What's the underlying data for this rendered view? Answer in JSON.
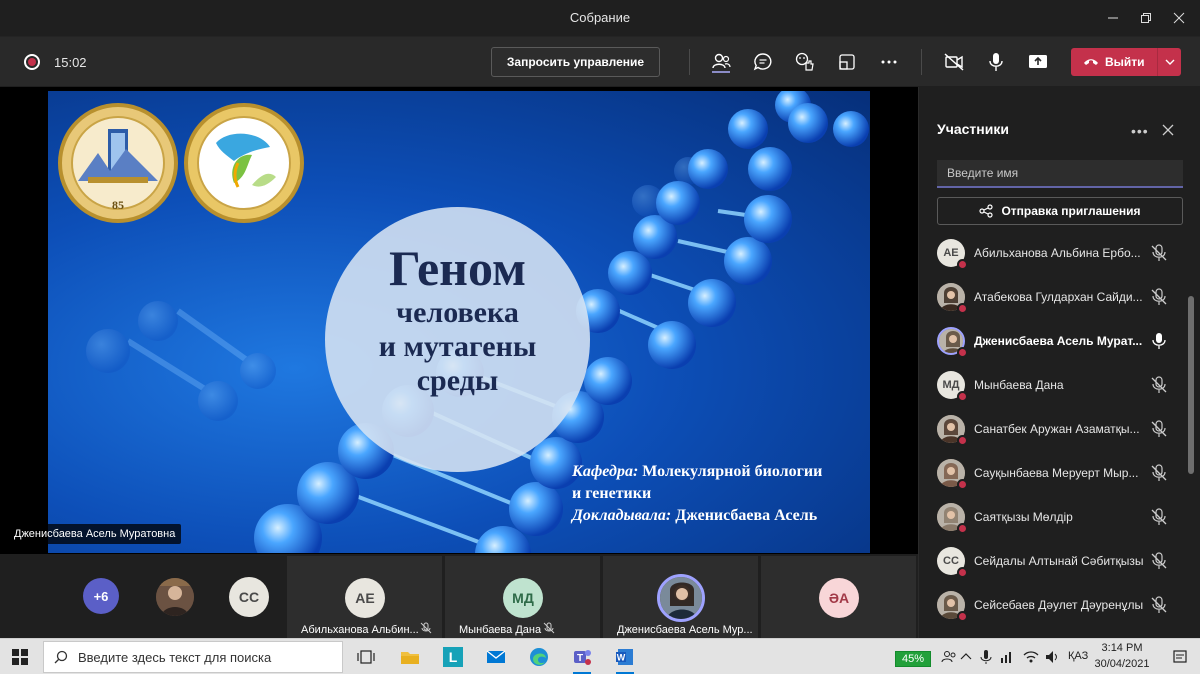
{
  "window": {
    "title": "Собрание"
  },
  "toolbar": {
    "timer": "15:02",
    "request_control_label": "Запросить управление",
    "leave_label": "Выйти"
  },
  "slide": {
    "title_line1": "Геном",
    "title_line2": "человека",
    "title_line3": "и мутагены",
    "title_line4": "среды",
    "dept_label": "Кафедра:",
    "dept_value": "Молекулярной биологии",
    "dept_value_cont": "и генетики",
    "speaker_label": "Докладывала:",
    "speaker_value": "Дженисбаева Асель",
    "logo_left_text": "ҚАЗАҚ ҰЛТТЫҚ УНИВЕРСИТЕТІ 85",
    "logo_right_text": "ҚАЗ ҰУ БИОЛОГИЯ ЖӘНЕ БИОТЕХНОЛОГИЯ ФАКУЛЬТЕТІ"
  },
  "presenter_label": "Дженисбаева Асель Муратовна",
  "panel": {
    "title": "Участники",
    "more": "•••",
    "search_placeholder": "Введите имя",
    "invite_label": "Отправка приглашения",
    "participants": [
      {
        "initials": "АЕ",
        "name": "Абильханова Альбина Ербо...",
        "avatar": "initials",
        "active": false
      },
      {
        "initials": "",
        "name": "Атабекова Гулдархан Сайди...",
        "avatar": "photo",
        "active": false
      },
      {
        "initials": "",
        "name": "Дженисбаева Асель Мурат...",
        "avatar": "photo",
        "active": true
      },
      {
        "initials": "МД",
        "name": "Мынбаева Дана",
        "avatar": "initials",
        "active": false
      },
      {
        "initials": "",
        "name": "Санатбек Аружан Азаматқы...",
        "avatar": "photo",
        "active": false
      },
      {
        "initials": "",
        "name": "Сауқынбаева Меруерт Мыр...",
        "avatar": "photo",
        "active": false
      },
      {
        "initials": "",
        "name": "Саятқызы Мөлдір",
        "avatar": "photo",
        "active": false
      },
      {
        "initials": "СС",
        "name": "Сейдалы Алтынай Сәбитқызы",
        "avatar": "initials",
        "active": false
      },
      {
        "initials": "",
        "name": "Сейсебаев Дәулет Дәуренұлы",
        "avatar": "photo",
        "active": false
      }
    ]
  },
  "strip": {
    "overflow_count": "+6",
    "cc_initials": "СС",
    "tiles": [
      {
        "initials": "АЕ",
        "label": "Абильханова Альбин..."
      },
      {
        "initials": "МД",
        "label": "Мынбаева Дана"
      },
      {
        "initials": "",
        "label": "Дженисбаева Асель Мур..."
      },
      {
        "initials": "ӘА",
        "label": ""
      }
    ]
  },
  "taskbar": {
    "search_placeholder": "Введите здесь текст для поиска",
    "battery": "45%",
    "lang": "ҚАЗ",
    "time": "3:14 PM",
    "date": "30/04/2021"
  },
  "colors": {
    "accent": "#6264a7",
    "leave": "#c4314b",
    "status_busy": "#c4314b",
    "battery": "#22a03a"
  }
}
